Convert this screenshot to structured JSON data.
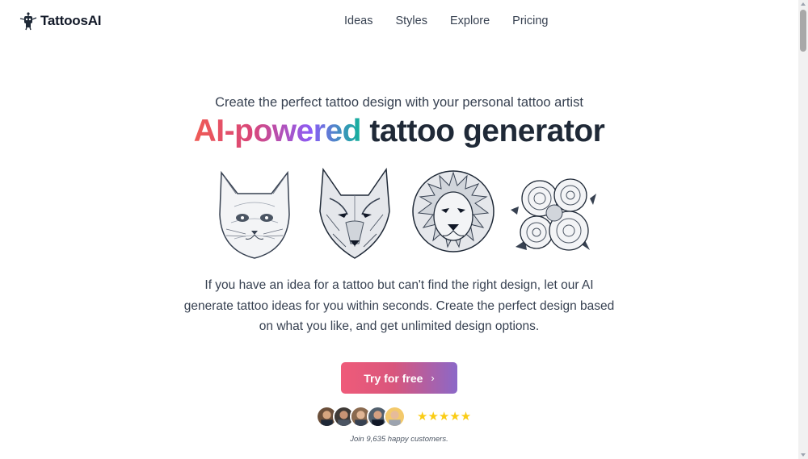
{
  "brand": {
    "name": "TattoosAI",
    "logo_icon": "robot-logo-icon"
  },
  "nav": {
    "items": [
      {
        "label": "Ideas"
      },
      {
        "label": "Styles"
      },
      {
        "label": "Explore"
      },
      {
        "label": "Pricing"
      }
    ]
  },
  "hero": {
    "subtitle": "Create the perfect tattoo design with your personal tattoo artist",
    "headline_gradient": "AI-powered",
    "headline_rest": " tattoo generator",
    "description": "If you have an idea for a tattoo but can't find the right design, let our AI generate tattoo ideas for you within seconds. Create the perfect design based on what you like, and get unlimited design options."
  },
  "gallery": {
    "items": [
      {
        "icon": "cat-tattoo-icon"
      },
      {
        "icon": "wolf-tattoo-icon"
      },
      {
        "icon": "lion-tattoo-icon"
      },
      {
        "icon": "roses-tattoo-icon"
      }
    ]
  },
  "cta": {
    "label": "Try for free",
    "chevron": "›"
  },
  "social_proof": {
    "avatar_count": 5,
    "stars": "★★★★★",
    "rating_stars": 5,
    "joined_text": "Join 9,635 happy customers."
  },
  "colors": {
    "star": "#facc15",
    "cta_start": "#ef5b7a",
    "cta_end": "#8b68c8",
    "text": "#1f2937"
  }
}
